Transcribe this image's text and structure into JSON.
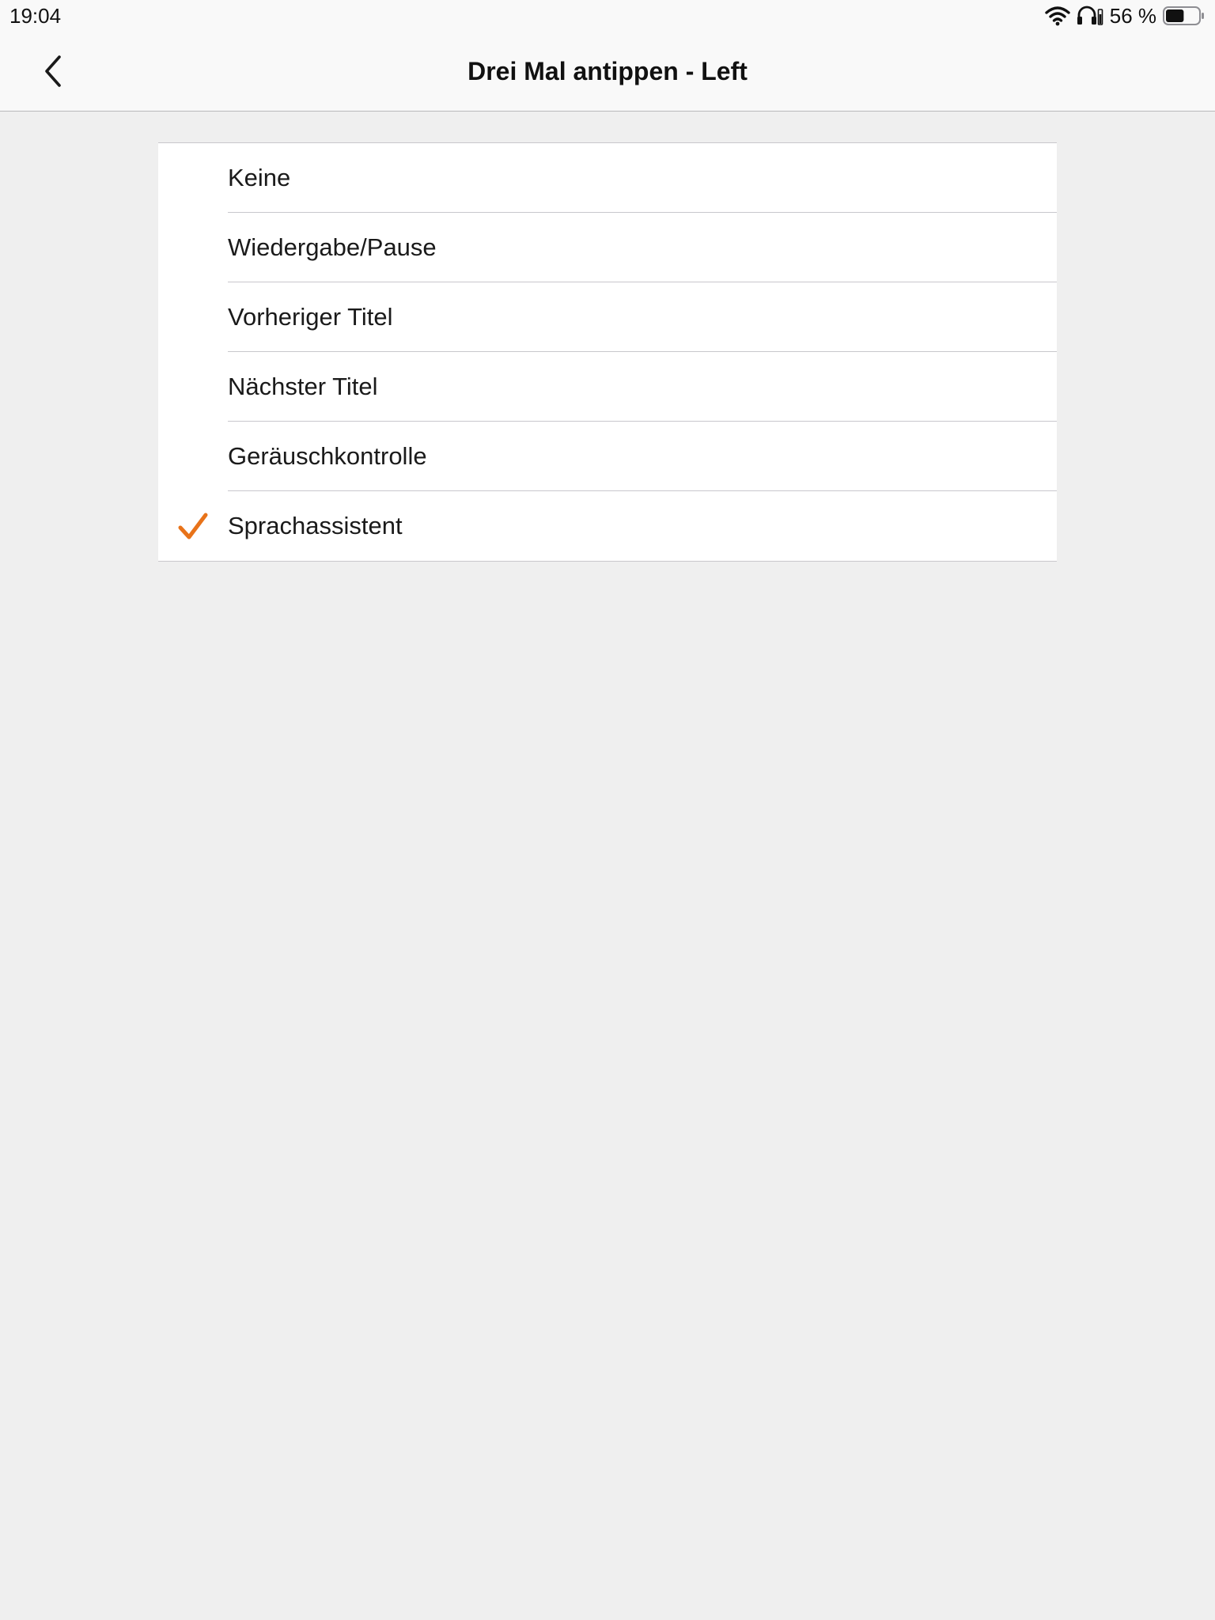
{
  "status_bar": {
    "time": "19:04",
    "battery_percent_text": "56 %",
    "battery_level": 0.56,
    "icons": [
      "wifi-icon",
      "headphones-icon",
      "battery-icon"
    ]
  },
  "nav": {
    "title": "Drei Mal antippen - Left",
    "back_icon": "chevron-left-icon"
  },
  "options": {
    "items": [
      {
        "label": "Keine",
        "selected": false
      },
      {
        "label": "Wiedergabe/Pause",
        "selected": false
      },
      {
        "label": "Vorheriger Titel",
        "selected": false
      },
      {
        "label": "Nächster Titel",
        "selected": false
      },
      {
        "label": "Geräuschkontrolle",
        "selected": false
      },
      {
        "label": "Sprachassistent",
        "selected": true
      }
    ]
  },
  "colors": {
    "accent": "#e8731a",
    "background": "#efefef",
    "bar_background": "#f9f9f9",
    "list_background": "#ffffff",
    "separator": "#c8c7cc"
  }
}
